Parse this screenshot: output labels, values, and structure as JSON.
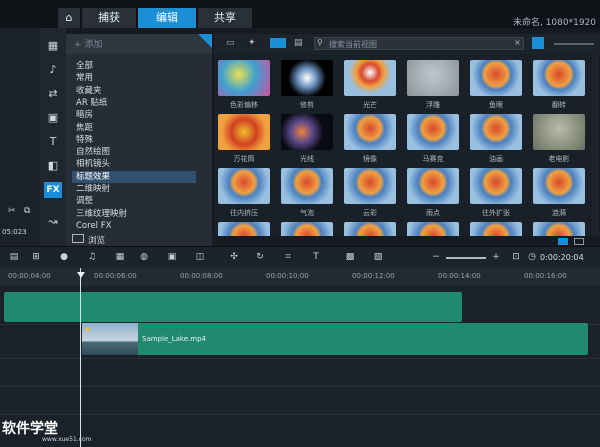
{
  "tabs": {
    "capture": "捕获",
    "edit": "编辑",
    "share": "共享"
  },
  "project": {
    "title": "未命名, 1080*1920"
  },
  "category_panel": {
    "add_label": "+ 添加",
    "items": [
      "全部",
      "常用",
      "收藏夹",
      "AR 贴纸",
      "暗房",
      "焦距",
      "特殊",
      "自然绘图",
      "相机镜头",
      "标题效果",
      "二维映射",
      "调整",
      "三维纹理映射",
      "Corel FX"
    ],
    "selected_index": 9,
    "browse_label": "浏览"
  },
  "library": {
    "search_placeholder": "搜索当前视图",
    "thumbnails": [
      "色彩偏移",
      "修剪",
      "光芒",
      "浮雕",
      "鱼眼",
      "翻转",
      "万花筒",
      "光线",
      "镜像",
      "马赛克",
      "油画",
      "老电影",
      "往内挤压",
      "气泡",
      "云彩",
      "雨点",
      "往外扩张",
      "涟漪",
      "",
      "",
      "",
      "",
      "",
      ""
    ]
  },
  "left_strip": {
    "time_label": "05:023"
  },
  "timeline": {
    "timecode": "0:00:20:04",
    "ruler_labels": [
      "00:00:04:00",
      "00:00:06:00",
      "00:00:08:00",
      "00:00:10:00",
      "00:00:12:00",
      "00:00:14:00",
      "00:00:16:00"
    ],
    "clip_name": "Sample_Lake.mp4"
  },
  "watermark": {
    "title": "软件学堂",
    "url": "www.xue51.com"
  },
  "colors": {
    "accent": "#1a8fd8",
    "clip": "#1f8a6e"
  }
}
